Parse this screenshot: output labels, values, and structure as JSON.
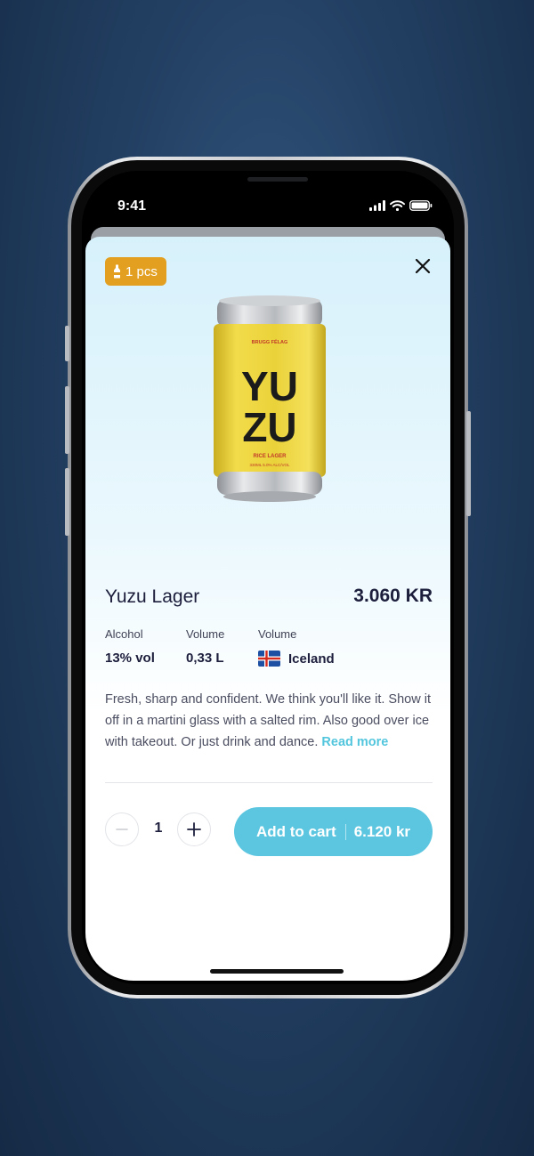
{
  "status_bar": {
    "time": "9:41",
    "icons": [
      "signal-bars-icon",
      "wifi-icon",
      "battery-icon"
    ]
  },
  "badge": {
    "icon": "bottle-icon",
    "label": "1 pcs",
    "color": "#e3a020"
  },
  "close": {
    "icon": "close-icon"
  },
  "product": {
    "image": {
      "can_brand": "BRUGG FÉLAG",
      "can_title_line1": "YU",
      "can_title_line2": "ZU",
      "can_subtitle": "RICE LAGER",
      "can_fineprint": "330ML 5.0% ALC/VOL"
    },
    "name": "Yuzu Lager",
    "price": "3.060 KR",
    "specs": [
      {
        "label": "Alcohol",
        "value": "13% vol"
      },
      {
        "label": "Volume",
        "value": "0,33 L"
      },
      {
        "label": "Volume",
        "value": "Iceland",
        "flag": "iceland-flag-icon"
      }
    ],
    "description": "Fresh, sharp and confident. We think you'll like it. Show it off in a martini glass with a salted rim. Also good over ice with takeout. Or just drink and dance.",
    "read_more": "Read more"
  },
  "cart": {
    "decrease_icon": "minus-icon",
    "increase_icon": "plus-icon",
    "quantity": "1",
    "add_label": "Add to cart",
    "total": "6.120 kr"
  },
  "colors": {
    "accent": "#5cc6e0",
    "badge": "#e3a020",
    "text_dark": "#1c1e3c",
    "link": "#53c6dd"
  }
}
